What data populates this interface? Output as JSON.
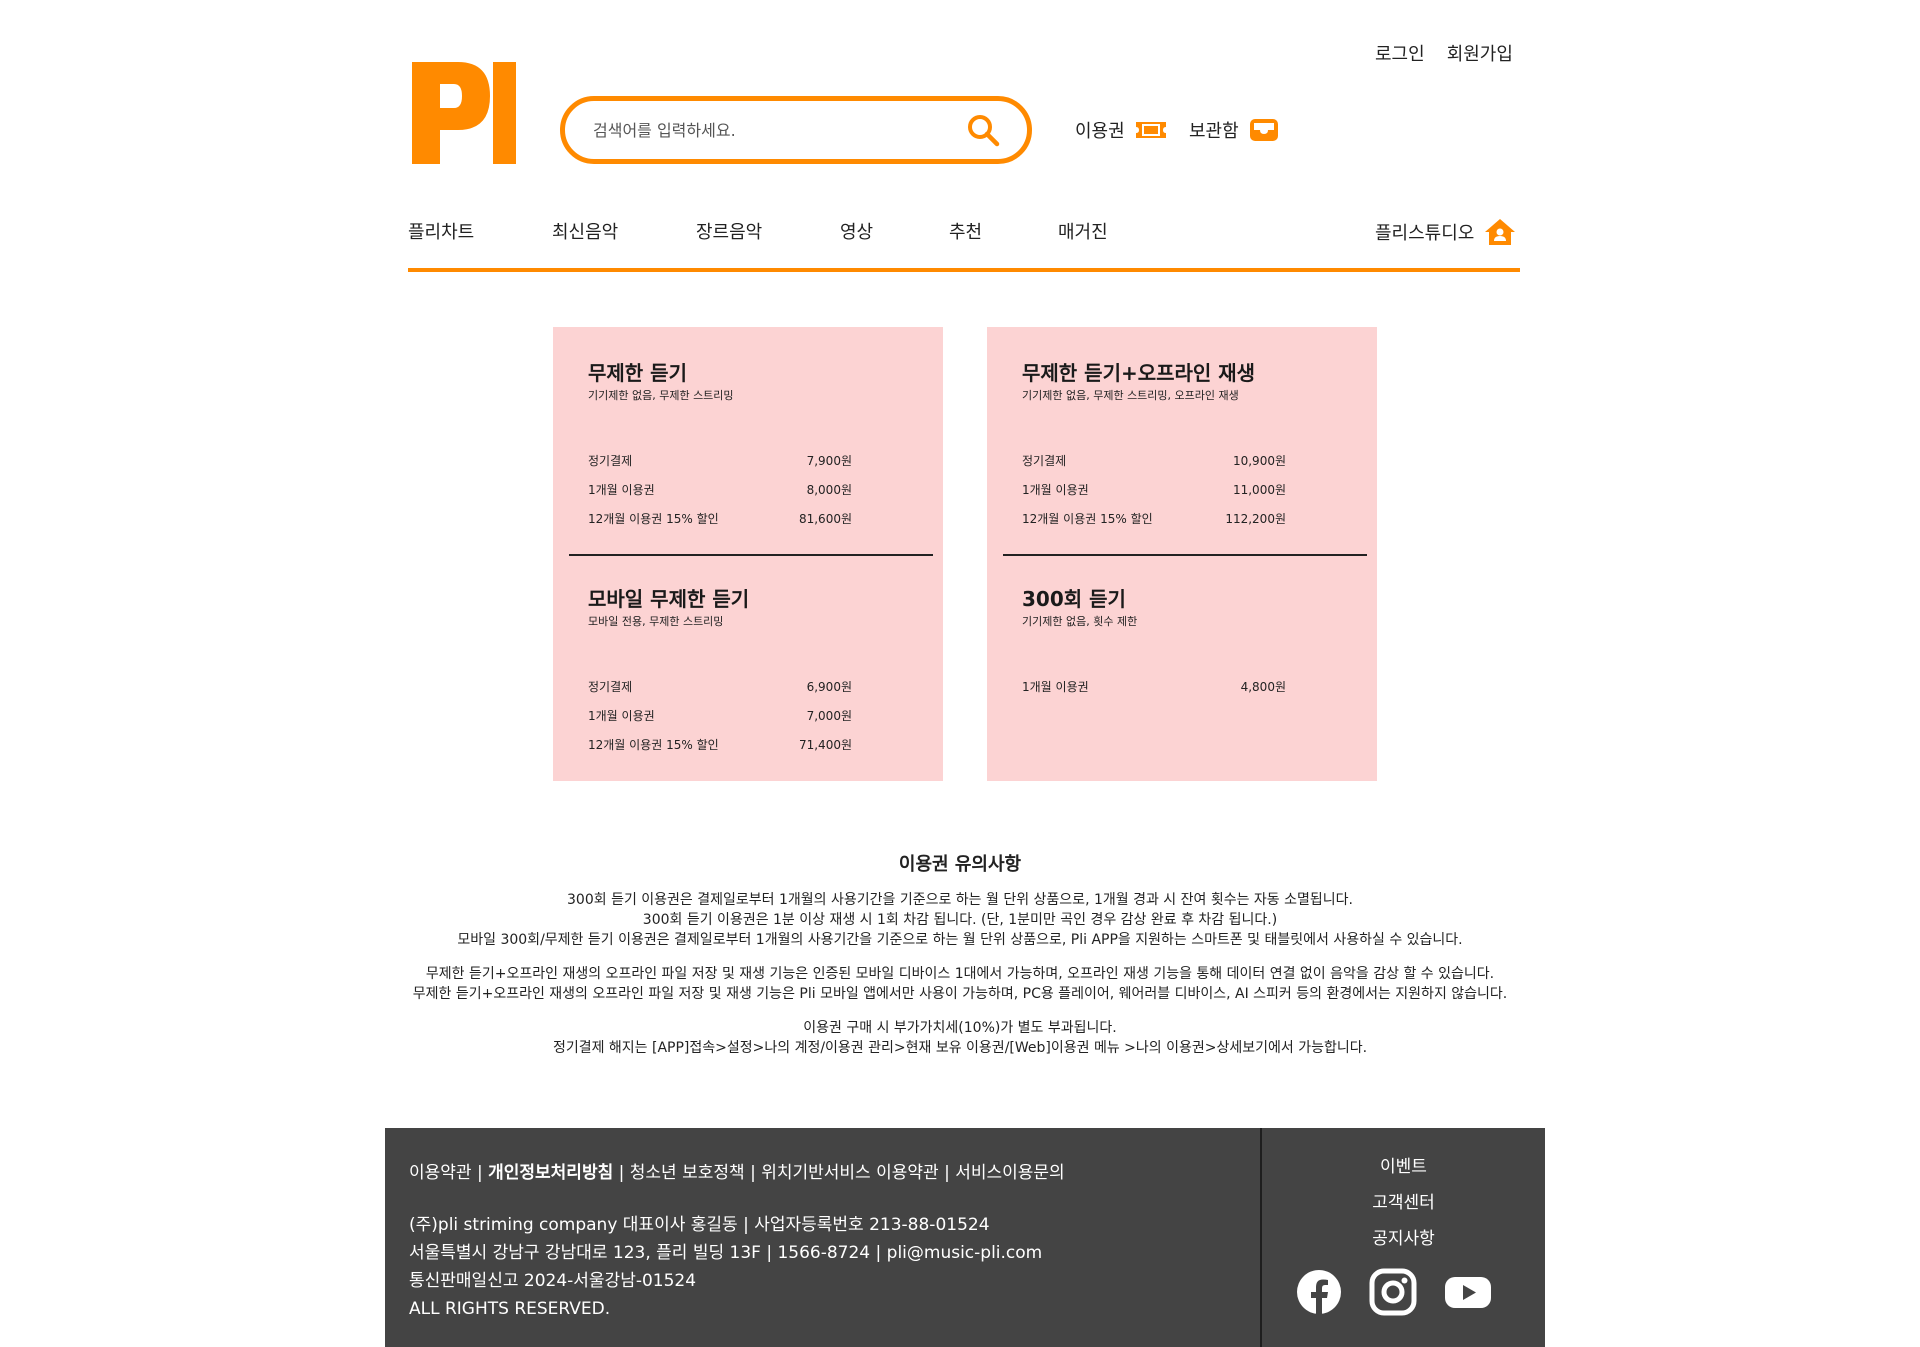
{
  "header": {
    "login": "로그인",
    "signup": "회원가입",
    "search_placeholder": "검색어를 입력하세요.",
    "ticket_label": "이용권",
    "storage_label": "보관함",
    "brand_color": "#ff8a00"
  },
  "nav": {
    "items": [
      "플리차트",
      "최신음악",
      "장르음악",
      "영상",
      "추천",
      "매거진"
    ],
    "studio": "플리스튜디오"
  },
  "plans": {
    "card_color": "#fcd3d3",
    "unlimited": {
      "title": "무제한 듣기",
      "subtitle": "기기제한 없음, 무제한 스트리밍",
      "rows": [
        {
          "label": "정기결제",
          "price": "7,900원"
        },
        {
          "label": "1개월 이용권",
          "price": "8,000원"
        },
        {
          "label": "12개월 이용권 15% 할인",
          "price": "81,600원"
        }
      ]
    },
    "unlimited_offline": {
      "title": "무제한 듣기+오프라인 재생",
      "subtitle": "기기제한 없음, 무제한 스트리밍, 오프라인 재생",
      "rows": [
        {
          "label": "정기결제",
          "price": "10,900원"
        },
        {
          "label": "1개월 이용권",
          "price": "11,000원"
        },
        {
          "label": "12개월 이용권 15% 할인",
          "price": "112,200원"
        }
      ]
    },
    "mobile": {
      "title": "모바일 무제한 듣기",
      "subtitle": "모바일 전용, 무제한 스트리밍",
      "rows": [
        {
          "label": "정기결제",
          "price": "6,900원"
        },
        {
          "label": "1개월 이용권",
          "price": "7,000원"
        },
        {
          "label": "12개월 이용권 15% 할인",
          "price": "71,400원"
        }
      ]
    },
    "count300": {
      "title": "300회 듣기",
      "subtitle": "기기제한 없음, 횟수 제한",
      "rows": [
        {
          "label": "1개월 이용권",
          "price": "4,800원"
        }
      ]
    }
  },
  "notes": {
    "title": "이용권 유의사항",
    "lines": [
      "300회 듣기 이용권은 결제일로부터 1개월의 사용기간을 기준으로 하는 월 단위 상품으로, 1개월 경과 시 잔여 횟수는 자동 소멸됩니다.",
      "300회 듣기 이용권은 1분 이상 재생 시 1회 차감 됩니다. (단, 1분미만 곡인 경우 감상 완료 후 차감 됩니다.)",
      "모바일 300회/무제한 듣기 이용권은 결제일로부터 1개월의 사용기간을 기준으로 하는 월 단위 상품으로, Pli APP을 지원하는 스마트폰 및 태블릿에서 사용하실 수 있습니다.",
      "무제한 듣기+오프라인 재생의 오프라인 파일 저장 및 재생 기능은 인증된 모바일 디바이스 1대에서 가능하며, 오프라인 재생 기능을 통해 데이터 연결 없이 음악을 감상 할 수 있습니다.",
      "무제한 듣기+오프라인 재생의 오프라인 파일 저장 및 재생 기능은 Pli 모바일 앱에서만 사용이 가능하며, PC용 플레이어, 웨어러블 디바이스, AI 스피커 등의 환경에서는 지원하지 않습니다.",
      "이용권 구매 시 부가가치세(10%)가 별도 부과됩니다.",
      "정기결제 해지는 [APP]접속>설정>나의 계정/이용권 관리>현재 보유 이용권/[Web]이용권 메뉴 >나의 이용권>상세보기에서 가능합니다."
    ]
  },
  "footer": {
    "bg_color": "#444444",
    "links": [
      "이용약관",
      "개인정보처리방침",
      "청소년 보호정책",
      "위치기반서비스 이용약관",
      "서비스이용문의"
    ],
    "separator": " | ",
    "info": [
      "(주)pli striming company 대표이사 홍길동 | 사업자등록번호 213-88-01524",
      "서울특별시 강남구 강남대로 123, 플리 빌딩 13F | 1566-8724 | pli@music-pli.com",
      "통신판매일신고 2024-서울강남-01524",
      "ALL RIGHTS RESERVED."
    ],
    "side_links": [
      "이벤트",
      "고객센터",
      "공지사항"
    ],
    "social_icons": [
      "facebook-icon",
      "instagram-icon",
      "youtube-icon"
    ]
  }
}
